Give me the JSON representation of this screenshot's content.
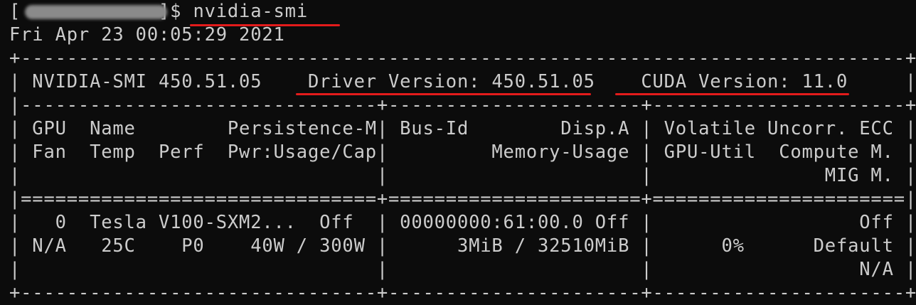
{
  "terminal": {
    "prompt_open": "[",
    "prompt_user_host_redacted": "          ",
    "prompt_suffix": " ~]$ ",
    "command": "nvidia-smi",
    "date_line": "Fri Apr 23 00:05:29 2021",
    "output_lines": [
      "+-----------------------------------------------------------------------------+",
      "| NVIDIA-SMI 450.51.05    Driver Version: 450.51.05    CUDA Version: 11.0     |",
      "|-------------------------------+----------------------+----------------------+",
      "| GPU  Name        Persistence-M| Bus-Id        Disp.A | Volatile Uncorr. ECC |",
      "| Fan  Temp  Perf  Pwr:Usage/Cap|         Memory-Usage | GPU-Util  Compute M. |",
      "|                               |                      |               MIG M. |",
      "|===============================+======================+======================|",
      "|   0  Tesla V100-SXM2...  Off  | 00000000:61:00.0 Off |                  Off |",
      "| N/A   25C    P0    40W / 300W |      3MiB / 32510MiB |      0%      Default |",
      "|                               |                      |                  N/A |",
      "+-------------------------------+----------------------+----------------------+"
    ],
    "highlight_color": "#e31b1b"
  }
}
